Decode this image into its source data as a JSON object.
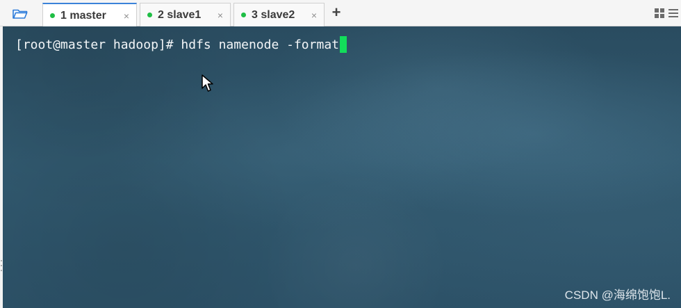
{
  "tabs": [
    {
      "label": "1 master",
      "status_color": "#1fbe45",
      "close_icon": "close-icon",
      "active": true
    },
    {
      "label": "2 slave1",
      "status_color": "#1fbe45",
      "close_icon": "close-icon",
      "active": false
    },
    {
      "label": "3 slave2",
      "status_color": "#1fbe45",
      "close_icon": "close-icon",
      "active": false
    }
  ],
  "toolbar": {
    "folder_icon": "folder-open-icon",
    "add_tab_label": "+",
    "grid_icon": "grid-icon",
    "menu_icon": "menu-icon"
  },
  "terminal": {
    "command": "[root@master hadoop]# hdfs namenode -format",
    "cursor_color": "#12dd5a",
    "background_color": "#31596f"
  },
  "watermark": "CSDN @海绵饱饱L."
}
